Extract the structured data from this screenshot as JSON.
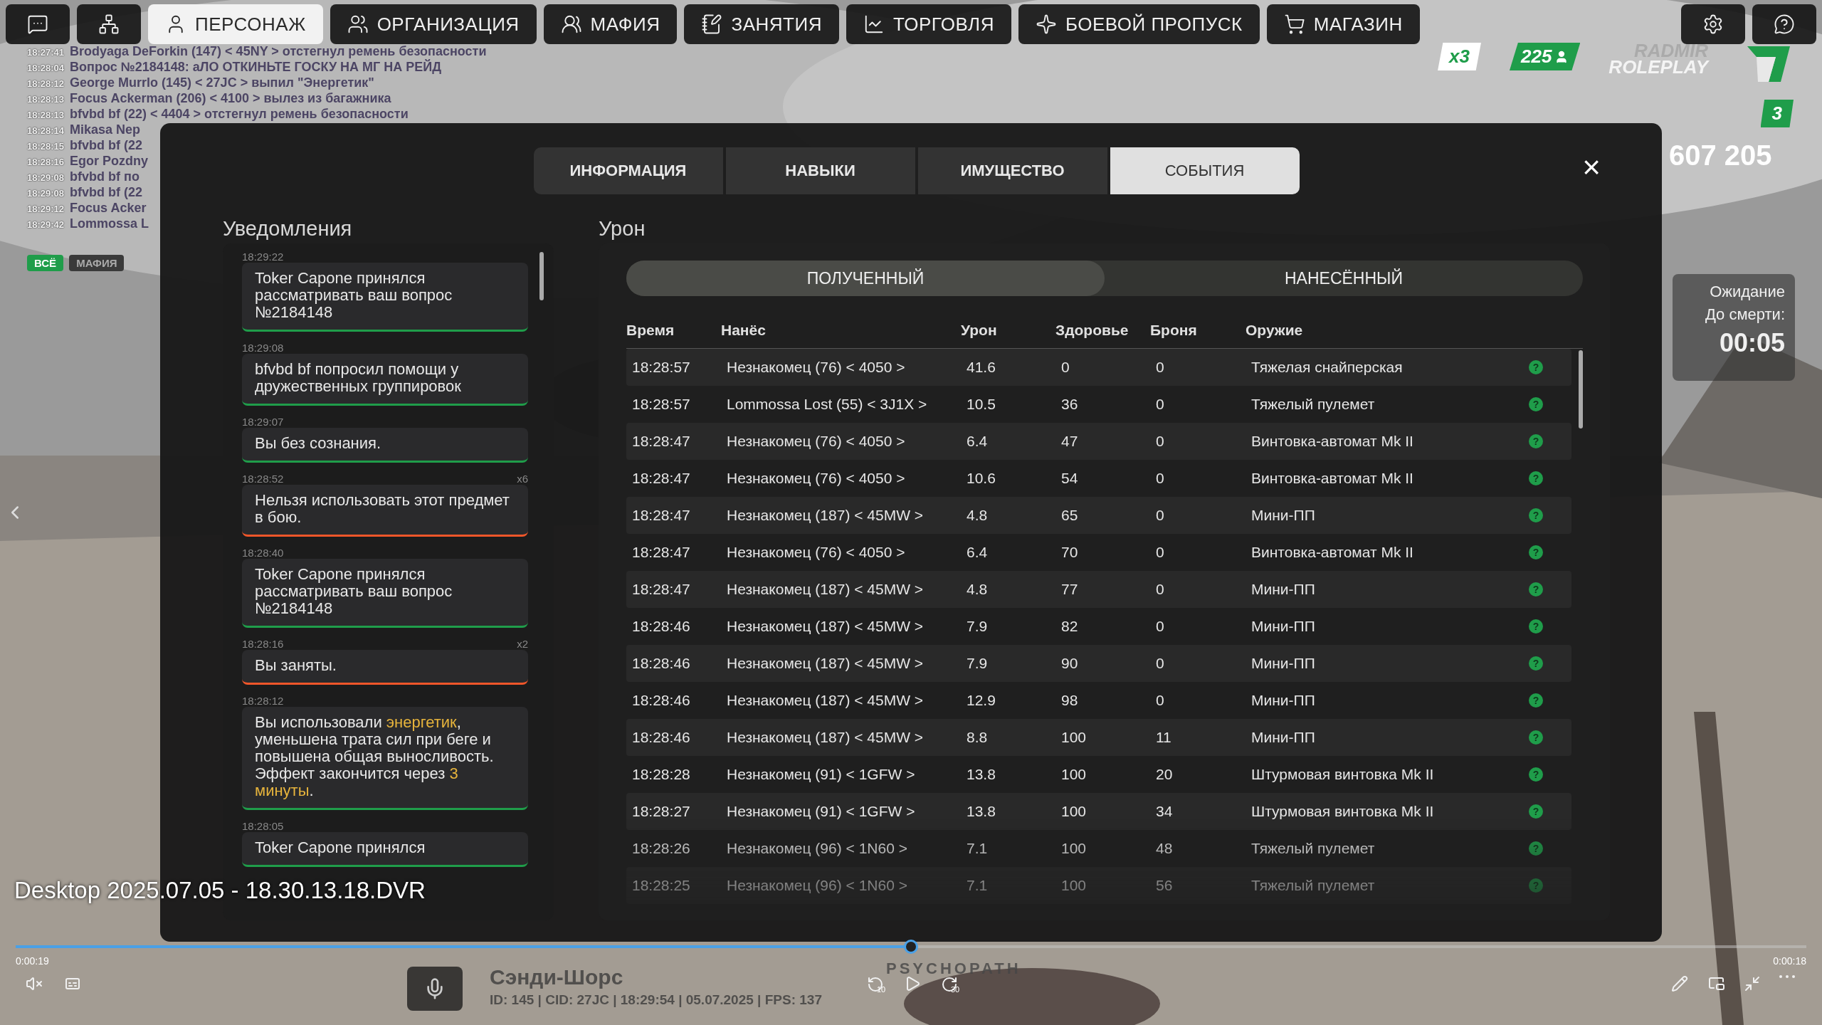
{
  "top_menu": {
    "items": [
      {
        "kind": "icon",
        "selected": false
      },
      {
        "kind": "icon",
        "selected": false
      },
      {
        "kind": "label",
        "label": "ПЕРСОНАЖ",
        "selected": true
      },
      {
        "kind": "label",
        "label": "ОРГАНИЗАЦИЯ",
        "selected": false
      },
      {
        "kind": "label",
        "label": "МАФИЯ",
        "selected": false
      },
      {
        "kind": "label",
        "label": "ЗАНЯТИЯ",
        "selected": false
      },
      {
        "kind": "label",
        "label": "ТОРГОВЛЯ",
        "selected": false
      },
      {
        "kind": "label",
        "label": "БОЕВОЙ ПРОПУСК",
        "selected": false
      },
      {
        "kind": "label",
        "label": "МАГАЗИН",
        "selected": false
      }
    ]
  },
  "chat": {
    "lines": [
      {
        "time": "18:27:41",
        "text": "Brodyaga DeForkin (147) < 45NY > отстегнул ремень безопасности"
      },
      {
        "time": "18:28:04",
        "text": "Вопрос №2184148: аЛО ОТКИНЬТЕ ГОСКУ НА МГ НА РЕЙД"
      },
      {
        "time": "18:28:12",
        "text": "George Murrlo (145) < 27JC > выпил \"Энергетик\""
      },
      {
        "time": "18:28:13",
        "text": "Focus Ackerman (206) < 4100 > вылез из багажника"
      },
      {
        "time": "18:28:13",
        "text": "bfvbd bf (22) < 4404 > отстегнул ремень безопасности"
      },
      {
        "time": "18:28:14",
        "text": "Mikasa Nep"
      },
      {
        "time": "18:28:15",
        "text": "bfvbd bf (22"
      },
      {
        "time": "18:28:16",
        "text": "Egor Pozdny"
      },
      {
        "time": "18:29:08",
        "text": "bfvbd bf по"
      },
      {
        "time": "18:29:08",
        "text": "bfvbd bf (22"
      },
      {
        "time": "18:29:12",
        "text": "Focus Acker"
      },
      {
        "time": "18:29:42",
        "text": "Lommossa L"
      }
    ],
    "filters": [
      {
        "label": "ВСЁ",
        "selected": true
      },
      {
        "label": "МАФИЯ",
        "selected": false
      }
    ]
  },
  "hud": {
    "multiplier": "x3",
    "online": "225",
    "logo_top": "RADMIR",
    "logo_bottom": "ROLEPLAY",
    "server": "3",
    "money": "607 205",
    "status": {
      "title": "Ожидание",
      "label": "До смерти:",
      "timer": "00:05"
    },
    "location": "Сэнди-Шорс",
    "info_line": "ID: 145 | CID: 27JC | 18:29:54  | 05.07.2025 | FPS: 137",
    "tag": "PSYCHOPATH"
  },
  "modal": {
    "tabs": [
      {
        "label": "ИНФОРМАЦИЯ",
        "selected": false
      },
      {
        "label": "НАВЫКИ",
        "selected": false
      },
      {
        "label": "ИМУЩЕСТВО",
        "selected": false
      },
      {
        "label": "СОБЫТИЯ",
        "selected": true
      }
    ],
    "close": "×",
    "notifications": {
      "title": "Уведомления",
      "items": [
        {
          "time": "18:29:22",
          "text": "Toker Capone принялся рассматривать ваш вопрос №2184148",
          "color": "#1f9d4a"
        },
        {
          "time": "18:29:08",
          "text": "bfvbd bf попросил помощи у дружественных группировок",
          "color": "#1f9d4a"
        },
        {
          "time": "18:29:07",
          "text": "Вы без сознания.",
          "color": "#1f9d4a"
        },
        {
          "time": "18:28:52",
          "count": "x6",
          "text": "Нельзя использовать этот предмет в бою.",
          "color": "#f0562a"
        },
        {
          "time": "18:28:40",
          "text": "Toker Capone принялся рассматривать ваш вопрос №2184148",
          "color": "#1f9d4a"
        },
        {
          "time": "18:28:16",
          "count": "x2",
          "text": "Вы заняты.",
          "color": "#f0562a"
        },
        {
          "time": "18:28:12",
          "text": "Вы использовали **энергетик**, уменьшена трата сил при беге и повышена общая выносливость. Эффект закончится через **3 минуты**.",
          "color": "#1f9d4a"
        },
        {
          "time": "18:28:05",
          "text": "Toker Capone принялся",
          "color": "#1f9d4a"
        }
      ]
    },
    "damage": {
      "title": "Урон",
      "toggle": [
        {
          "label": "ПОЛУЧЕННЫЙ",
          "selected": true
        },
        {
          "label": "НАНЕСЁННЫЙ",
          "selected": false
        }
      ],
      "columns": [
        "Время",
        "Нанёс",
        "Урон",
        "Здоровье",
        "Броня",
        "Оружие"
      ],
      "rows": [
        {
          "time": "18:28:57",
          "attacker": "Незнакомец (76) < 4050 >",
          "damage": "41.6",
          "health": "0",
          "armor": "0",
          "weapon": "Тяжелая снайперская",
          "info": "?"
        },
        {
          "time": "18:28:57",
          "attacker": "Lommossa Lost (55) < 3J1X >",
          "damage": "10.5",
          "health": "36",
          "armor": "0",
          "weapon": "Тяжелый пулемет",
          "info": "?"
        },
        {
          "time": "18:28:47",
          "attacker": "Незнакомец (76) < 4050 >",
          "damage": "6.4",
          "health": "47",
          "armor": "0",
          "weapon": "Винтовка-автомат Mk II",
          "info": "?"
        },
        {
          "time": "18:28:47",
          "attacker": "Незнакомец (76) < 4050 >",
          "damage": "10.6",
          "health": "54",
          "armor": "0",
          "weapon": "Винтовка-автомат Mk II",
          "info": "?"
        },
        {
          "time": "18:28:47",
          "attacker": "Незнакомец (187) < 45MW >",
          "damage": "4.8",
          "health": "65",
          "armor": "0",
          "weapon": "Мини-ПП",
          "info": "?"
        },
        {
          "time": "18:28:47",
          "attacker": "Незнакомец (76) < 4050 >",
          "damage": "6.4",
          "health": "70",
          "armor": "0",
          "weapon": "Винтовка-автомат Mk II",
          "info": "?"
        },
        {
          "time": "18:28:47",
          "attacker": "Незнакомец (187) < 45MW >",
          "damage": "4.8",
          "health": "77",
          "armor": "0",
          "weapon": "Мини-ПП",
          "info": "?"
        },
        {
          "time": "18:28:46",
          "attacker": "Незнакомец (187) < 45MW >",
          "damage": "7.9",
          "health": "82",
          "armor": "0",
          "weapon": "Мини-ПП",
          "info": "?"
        },
        {
          "time": "18:28:46",
          "attacker": "Незнакомец (187) < 45MW >",
          "damage": "7.9",
          "health": "90",
          "armor": "0",
          "weapon": "Мини-ПП",
          "info": "?"
        },
        {
          "time": "18:28:46",
          "attacker": "Незнакомец (187) < 45MW >",
          "damage": "12.9",
          "health": "98",
          "armor": "0",
          "weapon": "Мини-ПП",
          "info": "?"
        },
        {
          "time": "18:28:46",
          "attacker": "Незнакомец (187) < 45MW >",
          "damage": "8.8",
          "health": "100",
          "armor": "11",
          "weapon": "Мини-ПП",
          "info": "?"
        },
        {
          "time": "18:28:28",
          "attacker": "Незнакомец (91) < 1GFW >",
          "damage": "13.8",
          "health": "100",
          "armor": "20",
          "weapon": "Штурмовая винтовка Mk II",
          "info": "?"
        },
        {
          "time": "18:28:27",
          "attacker": "Незнакомец (91) < 1GFW >",
          "damage": "13.8",
          "health": "100",
          "armor": "34",
          "weapon": "Штурмовая винтовка Mk II",
          "info": "?"
        },
        {
          "time": "18:28:26",
          "attacker": "Незнакомец (96) < 1N60 >",
          "damage": "7.1",
          "health": "100",
          "armor": "48",
          "weapon": "Тяжелый пулемет",
          "info": "?"
        },
        {
          "time": "18:28:25",
          "attacker": "Незнакомец (96) < 1N60 >",
          "damage": "7.1",
          "health": "100",
          "armor": "56",
          "weapon": "Тяжелый пулемет",
          "info": "?"
        }
      ]
    }
  },
  "player": {
    "title": "Desktop 2025.07.05 - 18.30.13.18.DVR",
    "progress": {
      "level": 0.5
    },
    "elapsed": "0:00:19",
    "remaining": "0:00:18",
    "rewind": "10",
    "forward": "30"
  }
}
